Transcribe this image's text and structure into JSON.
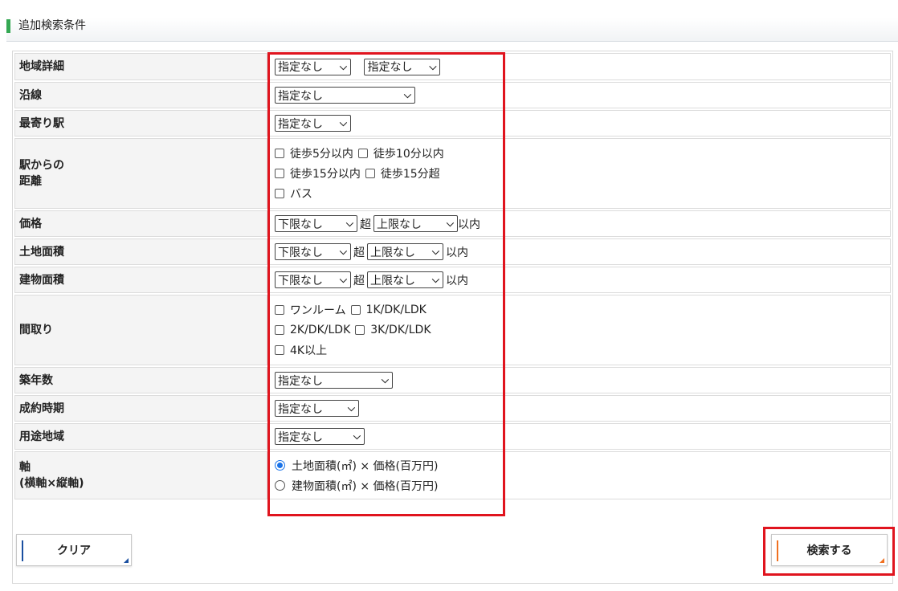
{
  "header": {
    "title": "追加検索条件"
  },
  "colors": {
    "accent_green": "#34a853",
    "highlight_red": "#e0141e",
    "clear_accent": "#1a4fa0",
    "search_accent": "#f07020",
    "radio_blue": "#1a73e8"
  },
  "rows": {
    "area": {
      "label": "地域詳細",
      "select1": "指定なし",
      "select2": "指定なし"
    },
    "line": {
      "label": "沿線",
      "select": "指定なし"
    },
    "station": {
      "label": "最寄り駅",
      "select": "指定なし"
    },
    "distance": {
      "label1": "駅からの",
      "label2": "距離",
      "options": [
        "徒歩5分以内",
        "徒歩10分以内",
        "徒歩15分以内",
        "徒歩15分超",
        "バス"
      ]
    },
    "price": {
      "label": "価格",
      "min": "下限なし",
      "sep": "超",
      "max": "上限なし",
      "suffix": "以内"
    },
    "land": {
      "label": "土地面積",
      "min": "下限なし",
      "sep": "超",
      "max": "上限なし",
      "suffix": "以内"
    },
    "building": {
      "label": "建物面積",
      "min": "下限なし",
      "sep": "超",
      "max": "上限なし",
      "suffix": "以内"
    },
    "layout": {
      "label": "間取り",
      "options": [
        "ワンルーム",
        "1K/DK/LDK",
        "2K/DK/LDK",
        "3K/DK/LDK",
        "4K以上"
      ]
    },
    "age": {
      "label": "築年数",
      "select": "指定なし"
    },
    "period": {
      "label": "成約時期",
      "select": "指定なし"
    },
    "zoning": {
      "label": "用途地域",
      "select": "指定なし"
    },
    "axis": {
      "label1": "軸",
      "label2": "(横軸×縦軸)",
      "options": [
        "土地面積(㎡) × 価格(百万円)",
        "建物面積(㎡) × 価格(百万円)"
      ],
      "selected_index": 0
    }
  },
  "buttons": {
    "clear": "クリア",
    "search": "検索する"
  },
  "icons": {
    "dropdown": "chevron-down-icon",
    "checkbox": "checkbox-icon",
    "radio": "radio-icon"
  }
}
